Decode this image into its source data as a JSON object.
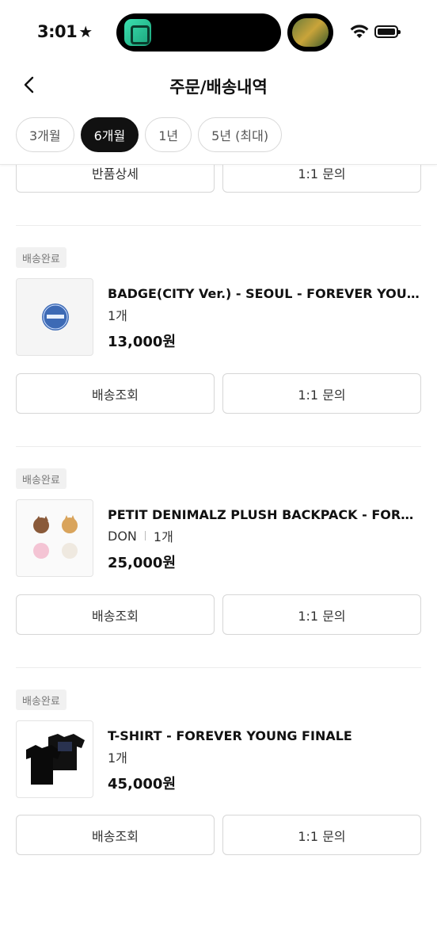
{
  "status_bar": {
    "time": "3:01",
    "star": "★"
  },
  "header": {
    "title": "주문/배송내역"
  },
  "filters": [
    {
      "label": "3개월",
      "active": false
    },
    {
      "label": "6개월",
      "active": true
    },
    {
      "label": "1년",
      "active": false
    },
    {
      "label": "5년 (최대)",
      "active": false
    }
  ],
  "prev_order_buttons": {
    "left": "반품상세",
    "right": "1:1 문의"
  },
  "orders": [
    {
      "status": "배송완료",
      "name": "BADGE(CITY Ver.) - SEOUL - FOREVER YOUNG FINALE",
      "option": "",
      "qty": "1개",
      "price": "13,000원",
      "btn_left": "배송조회",
      "btn_right": "1:1 문의"
    },
    {
      "status": "배송완료",
      "name": "PETIT DENIMALZ PLUSH BACKPACK - FOREVER YOUNG",
      "option": "DON",
      "qty": "1개",
      "price": "25,000원",
      "btn_left": "배송조회",
      "btn_right": "1:1 문의"
    },
    {
      "status": "배송완료",
      "name": "T-SHIRT - FOREVER YOUNG FINALE",
      "option": "",
      "qty": "1개",
      "price": "45,000원",
      "btn_left": "배송조회",
      "btn_right": "1:1 문의"
    }
  ]
}
